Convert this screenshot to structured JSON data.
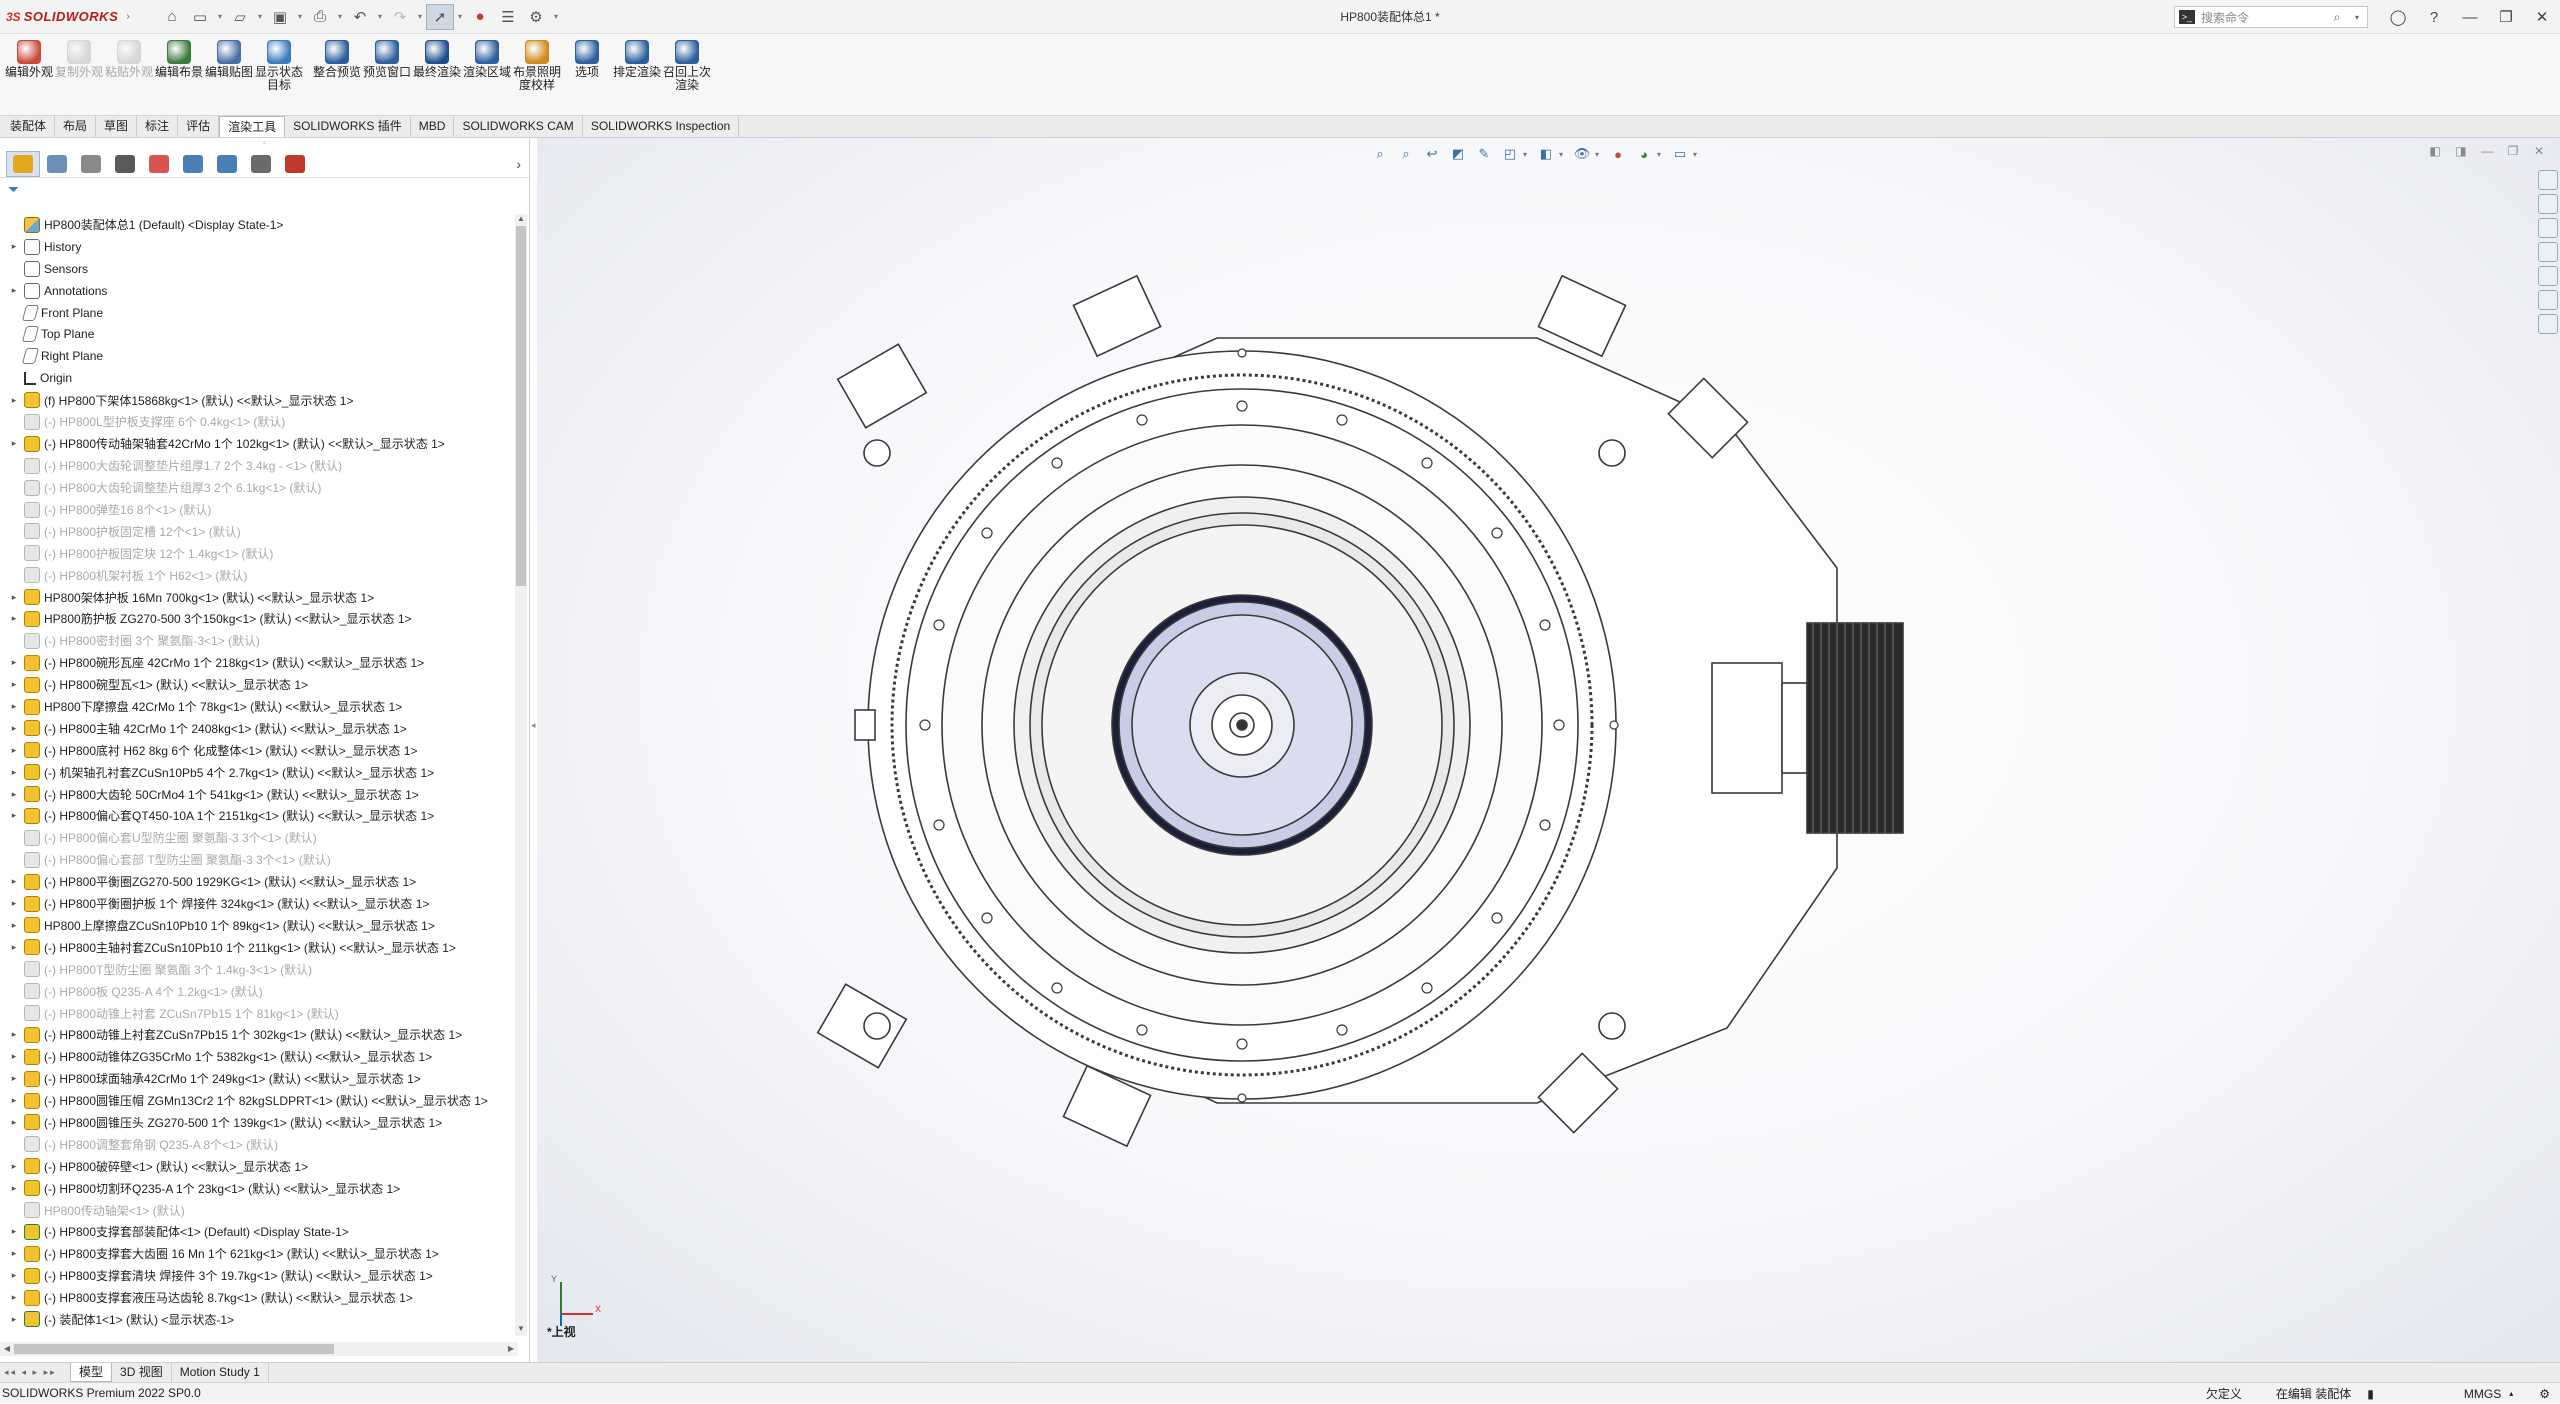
{
  "app": {
    "logo_ds": "3S",
    "logo_name": "SOLIDWORKS",
    "doc_title": "HP800装配体总1 *",
    "search_placeholder": "搜索命令"
  },
  "ribbon": [
    {
      "label": "编辑外观",
      "icon": "edit-appearance-icon",
      "color": "#c94a3a",
      "disabled": false
    },
    {
      "label": "复制外观",
      "icon": "copy-appearance-icon",
      "color": "#9c9c9c",
      "disabled": true
    },
    {
      "label": "粘贴外观",
      "icon": "paste-appearance-icon",
      "color": "#9c9c9c",
      "disabled": true
    },
    {
      "label": "编辑布景",
      "icon": "edit-scene-icon",
      "color": "#3d7a3d",
      "disabled": false
    },
    {
      "label": "编辑贴图",
      "icon": "edit-decal-icon",
      "color": "#4a6fa5",
      "disabled": false
    },
    {
      "label": "显示状态目标",
      "icon": "display-state-target-icon",
      "color": "#3b7bbf",
      "disabled": false
    },
    {
      "label": "整合预览",
      "icon": "integrated-preview-icon",
      "color": "#2b5f9e",
      "disabled": false
    },
    {
      "label": "预览窗口",
      "icon": "preview-window-icon",
      "color": "#2b5f9e",
      "disabled": false
    },
    {
      "label": "最终渲染",
      "icon": "final-render-icon",
      "color": "#1f4f8a",
      "disabled": false
    },
    {
      "label": "渲染区域",
      "icon": "render-region-icon",
      "color": "#2b5f9e",
      "disabled": false
    },
    {
      "label": "布景照明度校样",
      "icon": "scene-illumination-icon",
      "color": "#d08a1c",
      "disabled": false
    },
    {
      "label": "选项",
      "icon": "options-icon",
      "color": "#2b5f9e",
      "disabled": false
    },
    {
      "label": "排定渲染",
      "icon": "schedule-render-icon",
      "color": "#2b5f9e",
      "disabled": false
    },
    {
      "label": "召回上次渲染",
      "icon": "recall-last-render-icon",
      "color": "#2b5f9e",
      "disabled": false
    }
  ],
  "tabs": [
    {
      "label": "装配体",
      "active": false
    },
    {
      "label": "布局",
      "active": false
    },
    {
      "label": "草图",
      "active": false
    },
    {
      "label": "标注",
      "active": false
    },
    {
      "label": "评估",
      "active": false
    },
    {
      "label": "渲染工具",
      "active": true
    },
    {
      "label": "SOLIDWORKS 插件",
      "active": false
    },
    {
      "label": "MBD",
      "active": false
    },
    {
      "label": "SOLIDWORKS CAM",
      "active": false
    },
    {
      "label": "SOLIDWORKS Inspection",
      "active": false
    }
  ],
  "panel_tabs": [
    {
      "icon": "featuremanager-tab-icon",
      "color": "#e3a81f"
    },
    {
      "icon": "propertymanager-tab-icon",
      "color": "#6a8fb8"
    },
    {
      "icon": "configurationmanager-tab-icon",
      "color": "#8a8a8a"
    },
    {
      "icon": "dimxpert-tab-icon",
      "color": "#5a5a5a"
    },
    {
      "icon": "displaymanager-tab-icon",
      "color": "#d9534f"
    },
    {
      "icon": "cam-feature-tab-icon",
      "color": "#4a7fb5"
    },
    {
      "icon": "cam-operation-tab-icon",
      "color": "#4a7fb5"
    },
    {
      "icon": "cam-tools-tab-icon",
      "color": "#6b6b6b"
    },
    {
      "icon": "inspection-tab-icon",
      "color": "#c0392b"
    }
  ],
  "tree": [
    {
      "label": "HP800装配体总1 (Default) <Display State-1>",
      "type": "top",
      "expand": "",
      "suppressed": false
    },
    {
      "label": "History",
      "type": "hist",
      "expand": "▸",
      "suppressed": false
    },
    {
      "label": "Sensors",
      "type": "hist",
      "expand": "",
      "suppressed": false
    },
    {
      "label": "Annotations",
      "type": "hist",
      "expand": "▸",
      "suppressed": false
    },
    {
      "label": "Front Plane",
      "type": "plane",
      "expand": "",
      "suppressed": false
    },
    {
      "label": "Top Plane",
      "type": "plane",
      "expand": "",
      "suppressed": false
    },
    {
      "label": "Right Plane",
      "type": "plane",
      "expand": "",
      "suppressed": false
    },
    {
      "label": "Origin",
      "type": "origin",
      "expand": "",
      "suppressed": false
    },
    {
      "label": "(f) HP800下架体15868kg<1> (默认) <<默认>_显示状态 1>",
      "type": "asm",
      "expand": "▸",
      "suppressed": false
    },
    {
      "label": "(-) HP800L型护板支撑座 6个 0.4kg<1> (默认)",
      "type": "sup",
      "expand": "",
      "suppressed": true
    },
    {
      "label": "(-) HP800传动轴架轴套42CrMo 1个 102kg<1> (默认) <<默认>_显示状态 1>",
      "type": "asm",
      "expand": "▸",
      "suppressed": false
    },
    {
      "label": "(-) HP800大齿轮调整垫片组厚1.7 2个 3.4kg - <1> (默认)",
      "type": "sup",
      "expand": "",
      "suppressed": true
    },
    {
      "label": "(-) HP800大齿轮调整垫片组厚3 2个 6.1kg<1> (默认)",
      "type": "sup",
      "expand": "",
      "suppressed": true
    },
    {
      "label": "(-) HP800弹垫16 8个<1> (默认)",
      "type": "sup",
      "expand": "",
      "suppressed": true
    },
    {
      "label": "(-) HP800护板固定槽 12个<1> (默认)",
      "type": "sup",
      "expand": "",
      "suppressed": true
    },
    {
      "label": "(-) HP800护板固定块 12个 1.4kg<1> (默认)",
      "type": "sup",
      "expand": "",
      "suppressed": true
    },
    {
      "label": "(-) HP800机架衬板 1个 H62<1> (默认)",
      "type": "sup",
      "expand": "",
      "suppressed": true
    },
    {
      "label": "HP800架体护板 16Mn 700kg<1> (默认) <<默认>_显示状态 1>",
      "type": "asm",
      "expand": "▸",
      "suppressed": false
    },
    {
      "label": "HP800筋护板 ZG270-500 3个150kg<1> (默认) <<默认>_显示状态 1>",
      "type": "asm",
      "expand": "▸",
      "suppressed": false
    },
    {
      "label": "(-) HP800密封圈 3个 聚氨酯-3<1> (默认)",
      "type": "sup",
      "expand": "",
      "suppressed": true
    },
    {
      "label": "(-) HP800碗形瓦座 42CrMo 1个 218kg<1> (默认) <<默认>_显示状态 1>",
      "type": "asm",
      "expand": "▸",
      "suppressed": false
    },
    {
      "label": "(-) HP800碗型瓦<1> (默认) <<默认>_显示状态 1>",
      "type": "asm",
      "expand": "▸",
      "suppressed": false
    },
    {
      "label": "HP800下摩擦盘 42CrMo 1个 78kg<1> (默认) <<默认>_显示状态 1>",
      "type": "asm",
      "expand": "▸",
      "suppressed": false
    },
    {
      "label": "(-) HP800主轴 42CrMo 1个 2408kg<1> (默认) <<默认>_显示状态 1>",
      "type": "asm",
      "expand": "▸",
      "suppressed": false
    },
    {
      "label": "(-) HP800底衬 H62 8kg 6个 化成整体<1> (默认) <<默认>_显示状态 1>",
      "type": "asm",
      "expand": "▸",
      "suppressed": false
    },
    {
      "label": "(-) 机架轴孔衬套ZCuSn10Pb5 4个 2.7kg<1> (默认) <<默认>_显示状态 1>",
      "type": "asm",
      "expand": "▸",
      "suppressed": false
    },
    {
      "label": "(-) HP800大齿轮 50CrMo4 1个 541kg<1> (默认) <<默认>_显示状态 1>",
      "type": "asm",
      "expand": "▸",
      "suppressed": false
    },
    {
      "label": "(-) HP800偏心套QT450-10A 1个 2151kg<1> (默认) <<默认>_显示状态 1>",
      "type": "asm",
      "expand": "▸",
      "suppressed": false
    },
    {
      "label": "(-) HP800偏心套U型防尘圈 聚氨酯-3 3个<1> (默认)",
      "type": "sup",
      "expand": "",
      "suppressed": true
    },
    {
      "label": "(-) HP800偏心套部 T型防尘圈 聚氨酯-3 3个<1> (默认)",
      "type": "sup",
      "expand": "",
      "suppressed": true
    },
    {
      "label": "(-) HP800平衡圈ZG270-500 1929KG<1> (默认) <<默认>_显示状态 1>",
      "type": "asm",
      "expand": "▸",
      "suppressed": false
    },
    {
      "label": "(-) HP800平衡圈护板 1个 焊接件 324kg<1> (默认) <<默认>_显示状态 1>",
      "type": "asm",
      "expand": "▸",
      "suppressed": false
    },
    {
      "label": "HP800上摩擦盘ZCuSn10Pb10 1个 89kg<1> (默认) <<默认>_显示状态 1>",
      "type": "asm",
      "expand": "▸",
      "suppressed": false
    },
    {
      "label": "(-) HP800主轴衬套ZCuSn10Pb10 1个 211kg<1> (默认) <<默认>_显示状态 1>",
      "type": "asm",
      "expand": "▸",
      "suppressed": false
    },
    {
      "label": "(-) HP800T型防尘圈 聚氨酯 3个 1.4kg-3<1> (默认)",
      "type": "sup",
      "expand": "",
      "suppressed": true
    },
    {
      "label": "(-) HP800板 Q235-A 4个 1.2kg<1> (默认)",
      "type": "sup",
      "expand": "",
      "suppressed": true
    },
    {
      "label": "(-) HP800动锥上衬套 ZCuSn7Pb15 1个 81kg<1> (默认)",
      "type": "sup",
      "expand": "",
      "suppressed": true
    },
    {
      "label": "(-) HP800动锥上衬套ZCuSn7Pb15 1个 302kg<1> (默认) <<默认>_显示状态 1>",
      "type": "asm",
      "expand": "▸",
      "suppressed": false
    },
    {
      "label": "(-) HP800动锥体ZG35CrMo 1个 5382kg<1> (默认) <<默认>_显示状态 1>",
      "type": "asm",
      "expand": "▸",
      "suppressed": false
    },
    {
      "label": "(-) HP800球面轴承42CrMo 1个 249kg<1> (默认) <<默认>_显示状态 1>",
      "type": "asm",
      "expand": "▸",
      "suppressed": false
    },
    {
      "label": "(-) HP800圆锥压帽 ZGMn13Cr2 1个 82kgSLDPRT<1> (默认) <<默认>_显示状态 1>",
      "type": "asm",
      "expand": "▸",
      "suppressed": false
    },
    {
      "label": "(-) HP800圆锥压头 ZG270-500 1个 139kg<1> (默认) <<默认>_显示状态 1>",
      "type": "asm",
      "expand": "▸",
      "suppressed": false
    },
    {
      "label": "(-) HP800调整套角钢 Q235-A 8个<1> (默认)",
      "type": "sup",
      "expand": "",
      "suppressed": true
    },
    {
      "label": "(-) HP800破碎壁<1> (默认) <<默认>_显示状态 1>",
      "type": "asm",
      "expand": "▸",
      "suppressed": false
    },
    {
      "label": "(-) HP800切割环Q235-A 1个 23kg<1> (默认) <<默认>_显示状态 1>",
      "type": "asm",
      "expand": "▸",
      "suppressed": false
    },
    {
      "label": "HP800传动轴架<1> (默认)",
      "type": "sup",
      "expand": "",
      "suppressed": true
    },
    {
      "label": "(-) HP800支撑套部装配体<1> (Default) <Display State-1>",
      "type": "subasm",
      "expand": "▸",
      "suppressed": false
    },
    {
      "label": "(-) HP800支撑套大齿圈 16 Mn 1个 621kg<1> (默认) <<默认>_显示状态 1>",
      "type": "asm",
      "expand": "▸",
      "suppressed": false
    },
    {
      "label": "(-) HP800支撑套清块 焊接件 3个 19.7kg<1> (默认) <<默认>_显示状态 1>",
      "type": "asm",
      "expand": "▸",
      "suppressed": false
    },
    {
      "label": "(-) HP800支撑套液压马达齿轮 8.7kg<1> (默认) <<默认>_显示状态 1>",
      "type": "asm",
      "expand": "▸",
      "suppressed": false
    },
    {
      "label": "(-) 装配体1<1> (默认) <显示状态-1>",
      "type": "subasm",
      "expand": "▸",
      "suppressed": false
    }
  ],
  "viewport": {
    "view_label": "*上视",
    "triad_x": "X",
    "triad_y": "Y"
  },
  "bottom_tabs": [
    {
      "label": "模型",
      "active": true
    },
    {
      "label": "3D 视图",
      "active": false
    },
    {
      "label": "Motion Study 1",
      "active": false
    }
  ],
  "status": {
    "product": "SOLIDWORKS Premium 2022 SP0.0",
    "underdefined": "欠定义",
    "editing": "在编辑 装配体",
    "units": "MMGS"
  },
  "colors": {
    "accent": "#3b6fa5",
    "logo": "#d32f2f",
    "model_line": "#3a3a3a",
    "model_core": "#b9c0e0"
  }
}
